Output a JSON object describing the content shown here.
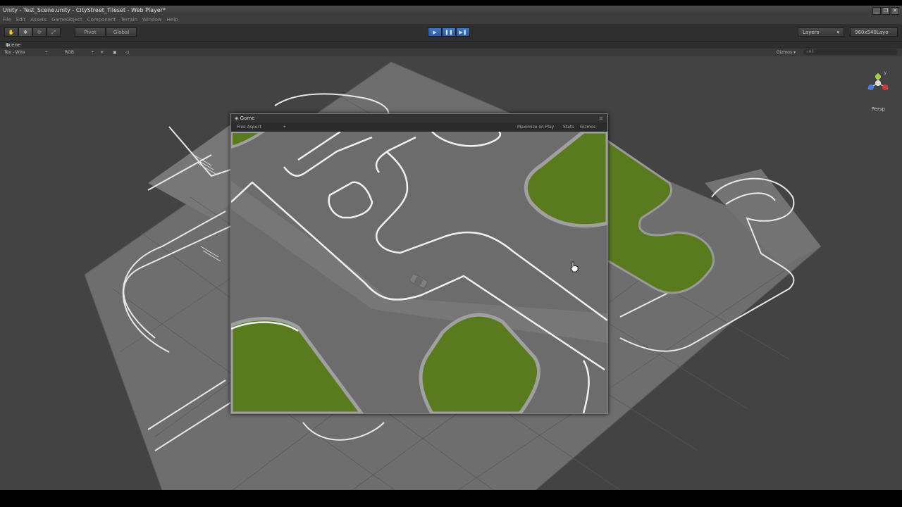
{
  "window": {
    "title": "Unity - Test_Scene.unity - CityStreet_Tileset - Web Player*",
    "controls": [
      "_",
      "❐",
      "✕"
    ]
  },
  "menu": [
    "File",
    "Edit",
    "Assets",
    "GameObject",
    "Component",
    "Terrain",
    "Window",
    "Help"
  ],
  "toolbar": {
    "pivot_label": "Pivot",
    "global_label": "Global",
    "layers_label": "Layers",
    "layout_label": "960x540Layo"
  },
  "scene": {
    "tab_label": "Scene",
    "render_mode": "Tex - Wire",
    "color_mode": "RGB",
    "gizmos_label": "Gizmos",
    "search_placeholder": "All",
    "persp_label": "Persp"
  },
  "game": {
    "tab_label": "Game",
    "aspect_label": "Free Aspect",
    "maximize_label": "Maximize on Play",
    "stats_label": "Stats",
    "gizmos_label": "Gizmos"
  },
  "colors": {
    "play_button": "#2f63a8",
    "grass": "#5a7a1e",
    "asphalt": "#6e6e6e",
    "editor_bg": "#3b3b3b"
  }
}
